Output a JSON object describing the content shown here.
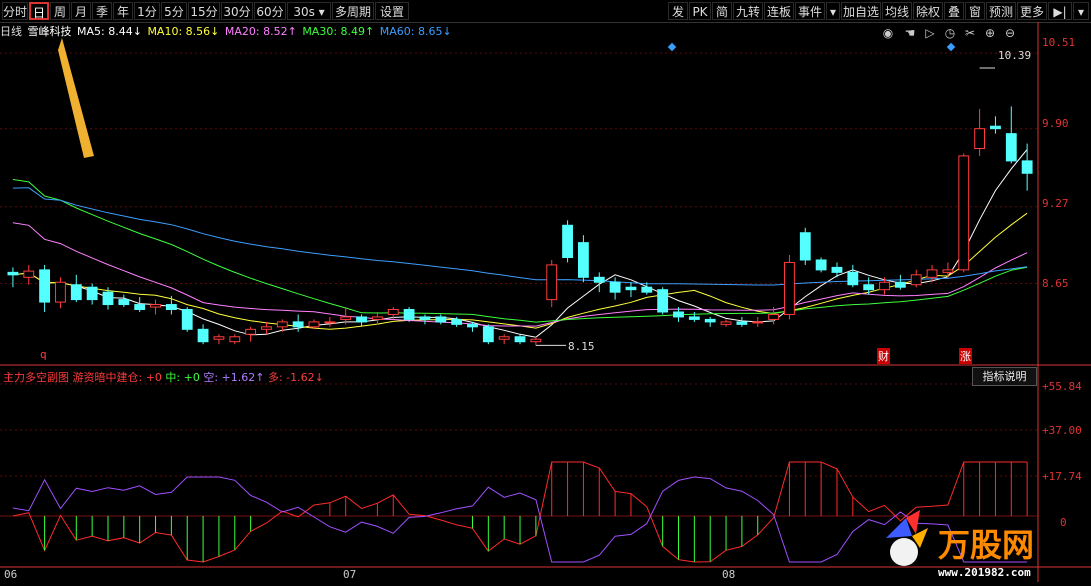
{
  "toolbar_left": [
    {
      "label": "分时"
    },
    {
      "label": "日",
      "active": true
    },
    {
      "label": "周"
    },
    {
      "label": "月"
    },
    {
      "label": "季"
    },
    {
      "label": "年"
    },
    {
      "label": "1分"
    },
    {
      "label": "5分"
    },
    {
      "label": "15分"
    },
    {
      "label": "30分"
    },
    {
      "label": "60分"
    },
    {
      "label": "30s ▾"
    },
    {
      "label": "多周期"
    },
    {
      "label": "设置"
    }
  ],
  "toolbar_right": [
    {
      "label": "发"
    },
    {
      "label": "PK"
    },
    {
      "label": "简"
    },
    {
      "label": "九转"
    },
    {
      "label": "连板"
    },
    {
      "label": "事件"
    },
    {
      "label": "▾"
    },
    {
      "label": "加自选"
    },
    {
      "label": "均线"
    },
    {
      "label": "除权"
    },
    {
      "label": "叠"
    },
    {
      "label": "窗"
    },
    {
      "label": "预测"
    },
    {
      "label": "更多"
    },
    {
      "label": "▶|"
    },
    {
      "label": "▾"
    }
  ],
  "info": {
    "period": "日线",
    "stock": "雪峰科技",
    "ma5": "MA5: 8.44↓",
    "ma10": "MA10: 8.56↓",
    "ma20": "MA20: 8.52↑",
    "ma30": "MA30: 8.49↑",
    "ma60": "MA60: 8.65↓"
  },
  "colors": {
    "up": "#ff3c3c",
    "down": "#54ffff",
    "ma5": "#ffffff",
    "ma10": "#ffff3c",
    "ma20": "#ff80ff",
    "ma30": "#3cff3c",
    "ma60": "#3c9eff",
    "axis": "#d33",
    "grid": "#5a0a0a"
  },
  "price_axis": [
    "10.51",
    "9.90",
    "9.27",
    "8.65"
  ],
  "price_annotations": {
    "high": "10.39",
    "low": "8.15"
  },
  "event_markers": [
    {
      "label": "q"
    },
    {
      "label": "财"
    },
    {
      "label": "涨"
    }
  ],
  "sub_indicator": {
    "name": "主力多空副图",
    "desc": "游资暗中建仓: +0",
    "mid": "中: +0",
    "empty": "空: +1.62↑",
    "more": "多: -1.62↓",
    "explain_button": "指标说明",
    "axis": [
      "+55.84",
      "+37.00",
      "+17.74",
      "0"
    ]
  },
  "x_axis": [
    "06",
    "07",
    "08"
  ],
  "watermark_text": "万股网",
  "watermark_url": "www.201982.com",
  "chart_data": {
    "type": "candlestick",
    "ylim": [
      8.0,
      10.6
    ],
    "candles": [
      [
        8.74,
        8.78,
        8.62,
        8.72
      ],
      [
        8.7,
        8.8,
        8.64,
        8.75
      ],
      [
        8.76,
        8.8,
        8.42,
        8.5
      ],
      [
        8.5,
        8.7,
        8.45,
        8.66
      ],
      [
        8.64,
        8.72,
        8.5,
        8.52
      ],
      [
        8.62,
        8.65,
        8.48,
        8.52
      ],
      [
        8.58,
        8.62,
        8.44,
        8.48
      ],
      [
        8.52,
        8.56,
        8.46,
        8.48
      ],
      [
        8.48,
        8.54,
        8.42,
        8.44
      ],
      [
        8.46,
        8.52,
        8.4,
        8.48
      ],
      [
        8.48,
        8.55,
        8.4,
        8.44
      ],
      [
        8.44,
        8.46,
        8.26,
        8.28
      ],
      [
        8.28,
        8.32,
        8.16,
        8.18
      ],
      [
        8.2,
        8.24,
        8.16,
        8.22
      ],
      [
        8.18,
        8.24,
        8.16,
        8.22
      ],
      [
        8.24,
        8.3,
        8.18,
        8.28
      ],
      [
        8.28,
        8.34,
        8.24,
        8.3
      ],
      [
        8.3,
        8.36,
        8.26,
        8.34
      ],
      [
        8.34,
        8.4,
        8.26,
        8.3
      ],
      [
        8.3,
        8.36,
        8.28,
        8.34
      ],
      [
        8.34,
        8.38,
        8.3,
        8.34
      ],
      [
        8.36,
        8.46,
        8.32,
        8.38
      ],
      [
        8.38,
        8.4,
        8.3,
        8.34
      ],
      [
        8.36,
        8.42,
        8.32,
        8.38
      ],
      [
        8.4,
        8.46,
        8.36,
        8.44
      ],
      [
        8.44,
        8.46,
        8.34,
        8.36
      ],
      [
        8.38,
        8.4,
        8.32,
        8.36
      ],
      [
        8.38,
        8.4,
        8.32,
        8.34
      ],
      [
        8.36,
        8.38,
        8.3,
        8.32
      ],
      [
        8.32,
        8.34,
        8.26,
        8.3
      ],
      [
        8.3,
        8.32,
        8.16,
        8.18
      ],
      [
        8.2,
        8.24,
        8.16,
        8.22
      ],
      [
        8.22,
        8.24,
        8.16,
        8.18
      ],
      [
        8.18,
        8.22,
        8.15,
        8.2
      ],
      [
        8.52,
        8.84,
        8.46,
        8.8
      ],
      [
        9.12,
        9.16,
        8.82,
        8.86
      ],
      [
        8.98,
        9.04,
        8.66,
        8.7
      ],
      [
        8.7,
        8.74,
        8.58,
        8.66
      ],
      [
        8.66,
        8.7,
        8.52,
        8.58
      ],
      [
        8.62,
        8.66,
        8.54,
        8.6
      ],
      [
        8.62,
        8.66,
        8.56,
        8.58
      ],
      [
        8.6,
        8.62,
        8.4,
        8.42
      ],
      [
        8.42,
        8.46,
        8.34,
        8.38
      ],
      [
        8.38,
        8.42,
        8.34,
        8.36
      ],
      [
        8.36,
        8.38,
        8.3,
        8.34
      ],
      [
        8.32,
        8.36,
        8.3,
        8.34
      ],
      [
        8.34,
        8.38,
        8.3,
        8.32
      ],
      [
        8.34,
        8.38,
        8.3,
        8.34
      ],
      [
        8.36,
        8.46,
        8.32,
        8.4
      ],
      [
        8.4,
        8.88,
        8.36,
        8.82
      ],
      [
        9.06,
        9.1,
        8.8,
        8.84
      ],
      [
        8.84,
        8.86,
        8.74,
        8.76
      ],
      [
        8.78,
        8.82,
        8.7,
        8.74
      ],
      [
        8.74,
        8.8,
        8.62,
        8.64
      ],
      [
        8.64,
        8.7,
        8.56,
        8.6
      ],
      [
        8.6,
        8.7,
        8.56,
        8.66
      ],
      [
        8.66,
        8.72,
        8.6,
        8.62
      ],
      [
        8.64,
        8.76,
        8.62,
        8.72
      ],
      [
        8.7,
        8.8,
        8.66,
        8.76
      ],
      [
        8.74,
        8.82,
        8.7,
        8.76
      ],
      [
        8.76,
        9.7,
        8.74,
        9.68
      ],
      [
        9.74,
        10.06,
        9.68,
        9.9
      ],
      [
        9.92,
        10.0,
        9.86,
        9.9
      ],
      [
        9.86,
        10.08,
        9.62,
        9.64
      ],
      [
        9.64,
        9.78,
        9.4,
        9.54
      ]
    ]
  }
}
